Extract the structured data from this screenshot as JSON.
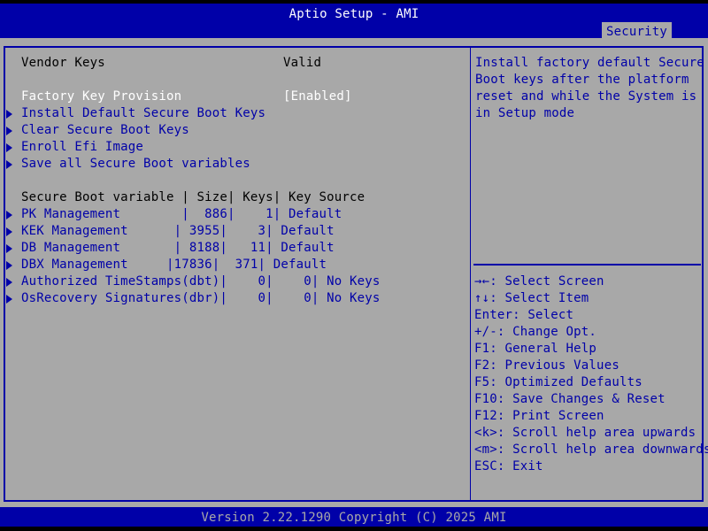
{
  "header": {
    "title": "Aptio Setup - AMI",
    "active_tab": "Security"
  },
  "main": {
    "vendor_keys_label": "Vendor Keys",
    "vendor_keys_value": "Valid",
    "factory_key_provision_label": "Factory Key Provision",
    "factory_key_provision_value": "[Enabled]",
    "submenus": [
      "Install Default Secure Boot Keys",
      "Clear Secure Boot Keys",
      "Enroll Efi Image",
      "Save all Secure Boot variables"
    ],
    "table_header": "Secure Boot variable | Size| Keys| Key Source",
    "table_rows": [
      "PK Management        |  886|    1| Default",
      "KEK Management      | 3955|    3| Default",
      "DB Management       | 8188|   11| Default",
      "DBX Management     |17836|  371| Default",
      "Authorized TimeStamps(dbt)|    0|    0| No Keys",
      "OsRecovery Signatures(dbr)|    0|    0| No Keys"
    ]
  },
  "help": {
    "description_lines": [
      "Install factory default Secure",
      "Boot keys after the platform",
      "reset and while the System is",
      "in Setup mode"
    ],
    "key_lines": [
      "→←: Select Screen",
      "↑↓: Select Item",
      "Enter: Select",
      "+/-: Change Opt.",
      "F1: General Help",
      "F2: Previous Values",
      "F5: Optimized Defaults",
      "F10: Save Changes & Reset",
      "F12: Print Screen",
      "<k>: Scroll help area upwards",
      "<m>: Scroll help area downwards",
      "ESC: Exit"
    ]
  },
  "footer": {
    "version_text": "Version 2.22.1290 Copyright (C) 2025 AMI"
  },
  "colors": {
    "background": "#a8a8a8",
    "bar": "#0000a8",
    "selected_text": "#ffffff",
    "link_text": "#0000a8"
  },
  "icons": {
    "submenu_marker": "triangle-right-icon"
  }
}
